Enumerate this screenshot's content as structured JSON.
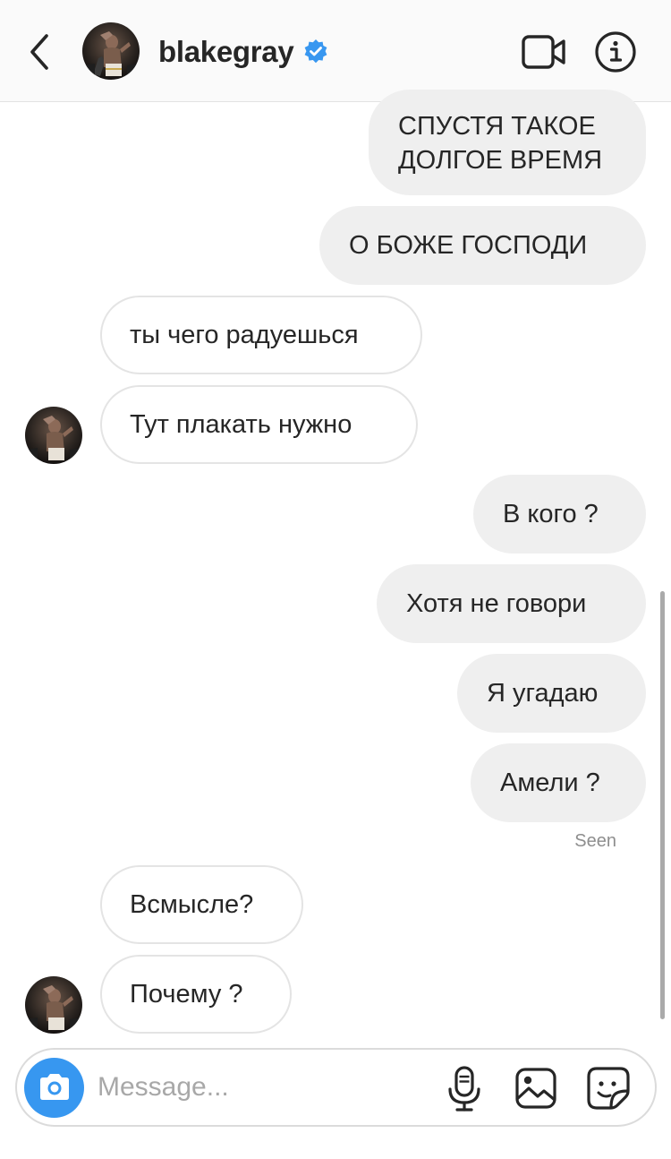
{
  "header": {
    "username": "blakegray",
    "verified": true,
    "back_icon": "chevron-left-icon",
    "video_icon": "video-camera-icon",
    "info_icon": "info-icon"
  },
  "messages": [
    {
      "direction": "out",
      "lines": [
        "СПУСТЯ ТАКОЕ",
        "ДОЛГОЕ ВРЕМЯ"
      ]
    },
    {
      "direction": "out",
      "text": "О БОЖЕ ГОСПОДИ"
    },
    {
      "direction": "in",
      "text": "ты чего радуешься"
    },
    {
      "direction": "in",
      "text": "Тут плакать нужно",
      "avatar": true
    },
    {
      "direction": "out",
      "text": "В кого ?"
    },
    {
      "direction": "out",
      "text": "Хотя не говори"
    },
    {
      "direction": "out",
      "text": "Я угадаю"
    },
    {
      "direction": "out",
      "text": "Амели ?"
    },
    {
      "direction": "in",
      "text": "Всмысле?"
    },
    {
      "direction": "in",
      "text": "Почему ?",
      "avatar": true
    }
  ],
  "status": {
    "seen_label": "Seen"
  },
  "composer": {
    "placeholder": "Message...",
    "camera_icon": "camera-icon",
    "mic_icon": "microphone-icon",
    "gallery_icon": "gallery-icon",
    "sticker_icon": "sticker-icon"
  },
  "colors": {
    "header_bg": "#fafafa",
    "outgoing_bubble": "#efefef",
    "incoming_border": "#e4e4e4",
    "accent_blue": "#3797f0",
    "verified_blue": "#3897f0",
    "seen_text": "#8e8e8e"
  }
}
